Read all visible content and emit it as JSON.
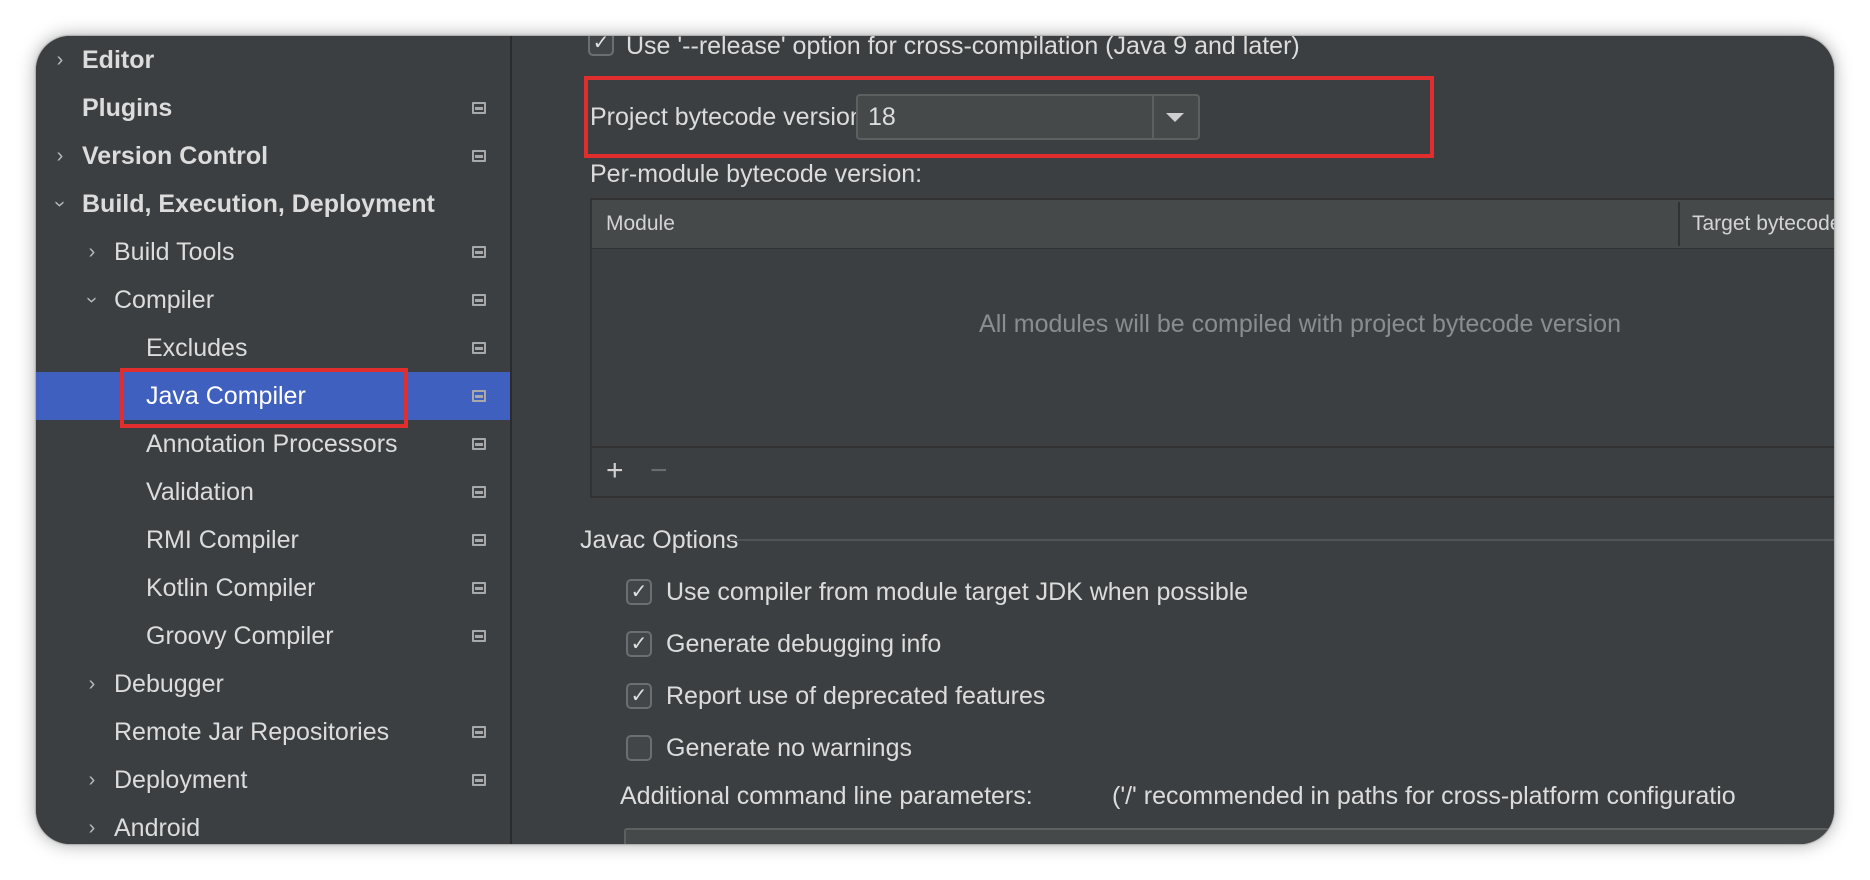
{
  "sidebar": {
    "items": [
      {
        "label": "Editor",
        "expanded": false
      },
      {
        "label": "Plugins"
      },
      {
        "label": "Version Control",
        "expanded": false
      },
      {
        "label": "Build, Execution, Deployment",
        "expanded": true
      },
      {
        "label": "Build Tools",
        "expanded": false
      },
      {
        "label": "Compiler",
        "expanded": true
      },
      {
        "label": "Excludes"
      },
      {
        "label": "Java Compiler",
        "selected": true
      },
      {
        "label": "Annotation Processors"
      },
      {
        "label": "Validation"
      },
      {
        "label": "RMI Compiler"
      },
      {
        "label": "Kotlin Compiler"
      },
      {
        "label": "Groovy Compiler"
      },
      {
        "label": "Debugger",
        "expanded": false
      },
      {
        "label": "Remote Jar Repositories"
      },
      {
        "label": "Deployment",
        "expanded": false
      },
      {
        "label": "Android",
        "expanded": false
      }
    ],
    "selected_color": "#4060c0"
  },
  "content": {
    "release_option": {
      "label": "Use '--release' option for cross-compilation (Java 9 and later)",
      "checked": true
    },
    "bytecode": {
      "label": "Project bytecode version:",
      "value": "18"
    },
    "per_module": {
      "label": "Per-module bytecode version:",
      "columns": [
        "Module",
        "Target bytecode"
      ],
      "empty_text": "All modules will be compiled with project bytecode version",
      "add_label": "+",
      "remove_label": "−"
    },
    "javac": {
      "title": "Javac Options",
      "options": [
        {
          "label": "Use compiler from module target JDK when possible",
          "checked": true
        },
        {
          "label": "Generate debugging info",
          "checked": true
        },
        {
          "label": "Report use of deprecated features",
          "checked": true
        },
        {
          "label": "Generate no warnings",
          "checked": false
        }
      ],
      "params_label": "Additional command line parameters:",
      "params_hint": "('/' recommended in paths for cross-platform configuratio"
    }
  },
  "colors": {
    "highlight": "#e02d2d",
    "background": "#3c3f41"
  }
}
